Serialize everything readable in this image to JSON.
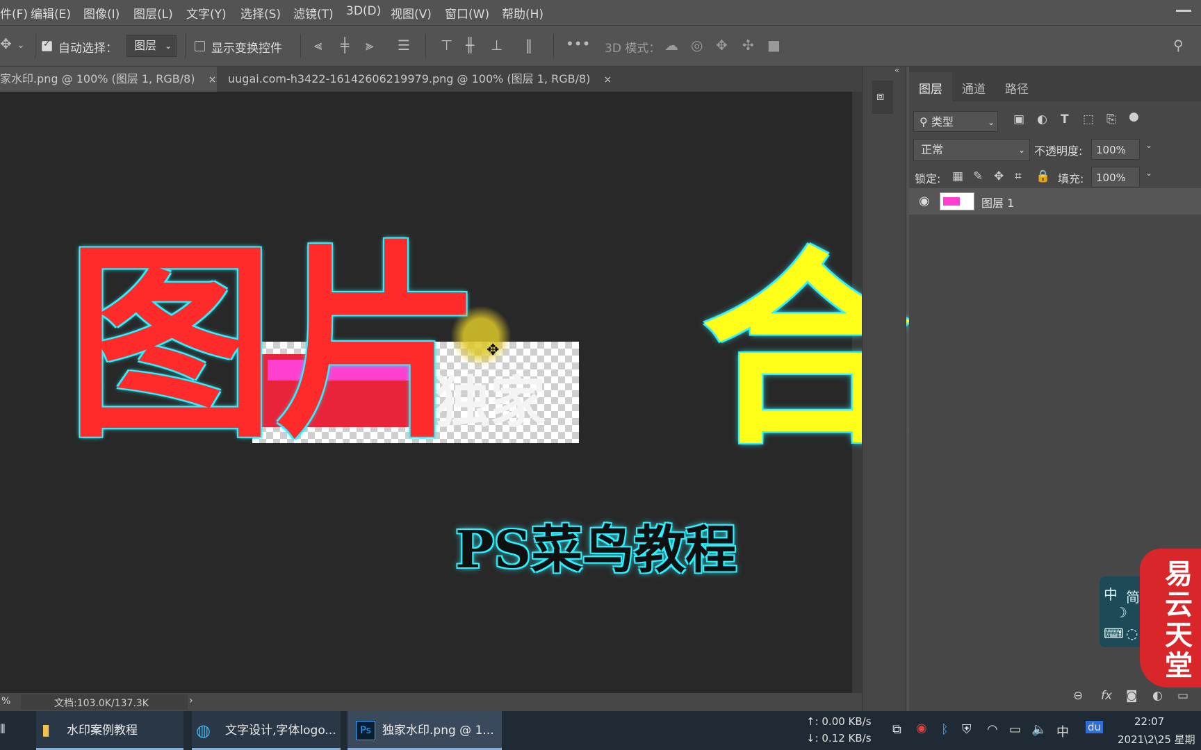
{
  "menubar": {
    "items": [
      "件(F)",
      "编辑(E)",
      "图像(I)",
      "图层(L)",
      "文字(Y)",
      "选择(S)",
      "滤镜(T)",
      "3D(D)",
      "视图(V)",
      "窗口(W)",
      "帮助(H)"
    ]
  },
  "options": {
    "auto_select_label": "自动选择：",
    "auto_select_value": "图层",
    "show_transform_label": "显示变换控件",
    "mode_3d_label": "3D 模式："
  },
  "tabs": [
    {
      "label": "家水印.png @ 100% (图层 1, RGB/8)",
      "active": true
    },
    {
      "label": "uugai.com-h3422-16142606219979.png @ 100% (图层 1, RGB/8)",
      "active": false
    }
  ],
  "tab_close": "×",
  "canvas": {
    "title_left": "图片",
    "title_right": "合成",
    "subtitle": "PS菜鸟教程",
    "watermark_text": "独家"
  },
  "status": {
    "zoom": "%",
    "doc_size": "文档:103.0K/137.3K"
  },
  "layers_panel": {
    "tabs": [
      "图层",
      "通道",
      "路径"
    ],
    "filter_label": "类型",
    "blend_mode": "正常",
    "opacity_label": "不透明度:",
    "opacity_value": "100%",
    "lock_label": "锁定:",
    "fill_label": "填充:",
    "fill_value": "100%",
    "layer_name": "图层 1"
  },
  "taskbar": {
    "items": [
      "水印案例教程",
      "文字设计,字体logo...",
      "独家水印.png @ 1..."
    ],
    "net_up": "↑: 0.00 KB/s",
    "net_down": "↓: 0.12 KB/s",
    "ime": "中",
    "time": "22:07",
    "date": "2021\\2\\25 星期"
  },
  "overlay": {
    "stamp_text": "易云天堂",
    "ime_widget": [
      "中",
      "简"
    ]
  },
  "colors": {
    "title_red": "#ff2a2a",
    "title_yellow": "#ffff19",
    "glow_cyan": "#30f0ff"
  }
}
